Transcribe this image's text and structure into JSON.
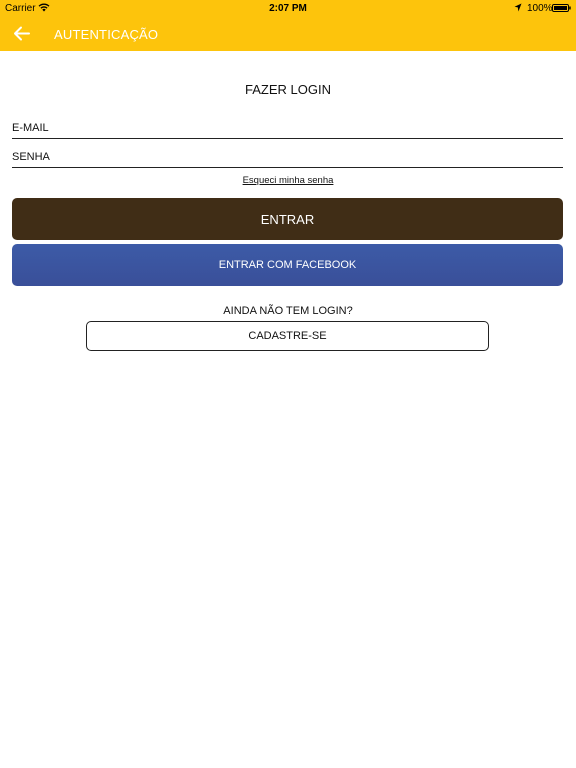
{
  "status_bar": {
    "carrier": "Carrier",
    "time": "2:07 PM",
    "battery": "100%"
  },
  "nav": {
    "title": "AUTENTICAÇÃO",
    "back_icon": "arrow-left-icon"
  },
  "login": {
    "heading": "FAZER LOGIN",
    "email_placeholder": "E-MAIL",
    "password_placeholder": "SENHA",
    "forgot_password": "Esqueci minha senha",
    "enter_label": "ENTRAR",
    "facebook_label": "ENTRAR COM FACEBOOK"
  },
  "signup": {
    "prompt": "AINDA NÃO TEM LOGIN?",
    "button_label": "CADASTRE-SE"
  },
  "colors": {
    "primary": "#fdc40c",
    "enter_button": "#402d16",
    "facebook_button": "#3b55a0"
  }
}
